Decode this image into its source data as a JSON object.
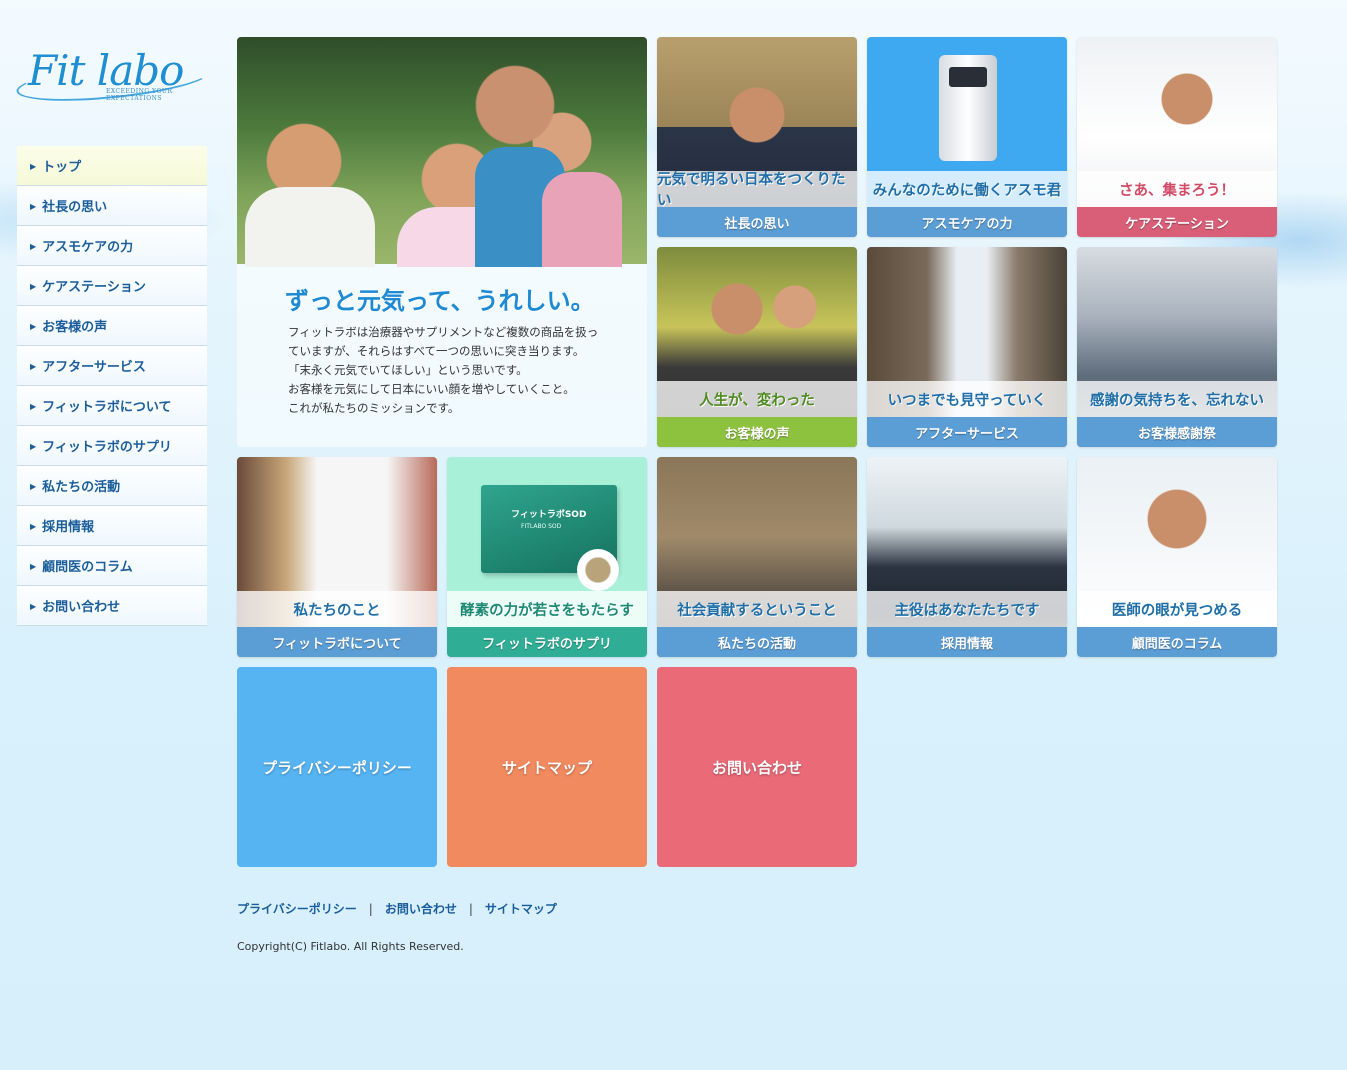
{
  "logo": {
    "text": "Fit labo",
    "tagline": "EXCEEDING YOUR EXPECTATIONS"
  },
  "sidenav": {
    "items": [
      {
        "label": "トップ"
      },
      {
        "label": "社長の思い"
      },
      {
        "label": "アスモケアの力"
      },
      {
        "label": "ケアステーション"
      },
      {
        "label": "お客様の声"
      },
      {
        "label": "アフターサービス"
      },
      {
        "label": "フィットラボについて"
      },
      {
        "label": "フィットラボのサプリ"
      },
      {
        "label": "私たちの活動"
      },
      {
        "label": "採用情報"
      },
      {
        "label": "顧問医のコラム"
      },
      {
        "label": "お問い合わせ"
      }
    ]
  },
  "hero": {
    "title": "ずっと元気って、うれしい。",
    "body": [
      "フィットラボは治療器やサプリメントなど複数の商品を扱っ",
      "ていますが、それらはすべて一つの思いに突き当ります。",
      "「末永く元気でいてほしい」という思いです。",
      "お客様を元気にして日本にいい顔を増やしていくこと。",
      "これが私たちのミッションです。"
    ]
  },
  "tiles": [
    {
      "caption": "元気で明るい日本をつくりたい",
      "label": "社長の思い"
    },
    {
      "caption": "みんなのために働くアスモ君",
      "label": "アスモケアの力"
    },
    {
      "caption": "さあ、集まろう！",
      "label": "ケアステーション"
    },
    {
      "caption": "人生が、変わった",
      "label": "お客様の声"
    },
    {
      "caption": "いつまでも見守っていく",
      "label": "アフターサービス"
    },
    {
      "caption": "感謝の気持ちを、忘れない",
      "label": "お客様感謝祭"
    },
    {
      "caption": "私たちのこと",
      "label": "フィットラボについて"
    },
    {
      "caption": "酵素の力が若さをもたらす",
      "label": "フィットラボのサプリ",
      "product": "フィットラボSOD",
      "product_sub": "FITLABO SOD"
    },
    {
      "caption": "社会貢献するということ",
      "label": "私たちの活動"
    },
    {
      "caption": "主役はあなたたちです",
      "label": "採用情報"
    },
    {
      "caption": "医師の眼が見つめる",
      "label": "顧問医のコラム"
    }
  ],
  "big_tiles": [
    {
      "label": "プライバシーポリシー",
      "color": "#56b4f2"
    },
    {
      "label": "サイトマップ",
      "color": "#f28a60"
    },
    {
      "label": "お問い合わせ",
      "color": "#ea6a78"
    }
  ],
  "footer": {
    "links": [
      "プライバシーポリシー",
      "お問い合わせ",
      "サイトマップ"
    ],
    "separator": "|",
    "copyright": "Copyright(C) Fitlabo. All Rights Reserved."
  },
  "colors": {
    "bar_blue": "#5b9ed6",
    "bar_pink": "#d95f78",
    "bar_green": "#8dc23f",
    "bar_teal": "#2fae95",
    "caption_blue": "#1f6ea8",
    "caption_pink": "#d24a66",
    "caption_green": "#4e8a1f",
    "caption_teal": "#1c8a73"
  }
}
